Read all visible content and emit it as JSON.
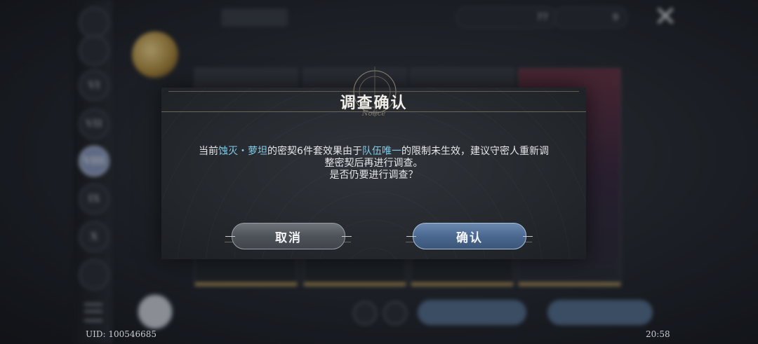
{
  "background": {
    "uid": "UID: 100546685",
    "clock": "20:58",
    "resources": [
      {
        "name": "currency-1",
        "value": "77"
      },
      {
        "name": "currency-2",
        "value": "9"
      }
    ],
    "rail": [
      "VI",
      "VII",
      "VIII",
      "IX",
      "X"
    ]
  },
  "dialog": {
    "title": "调查确认",
    "subtitle": "Notice",
    "message": {
      "part1": "当前",
      "highlight1": "蚀灭・萝坦",
      "part2": "的密契6件套效果由于",
      "highlight2": "队伍唯一",
      "part3": "的限制未生效，建议守密人重新调整密契后再进行调查。",
      "line3": "是否仍要进行调查？"
    },
    "cancel_label": "取消",
    "confirm_label": "确认"
  },
  "colors": {
    "highlight": "#7fcbe8",
    "confirm_button": "#4a6890",
    "cancel_button": "#4e535a"
  }
}
